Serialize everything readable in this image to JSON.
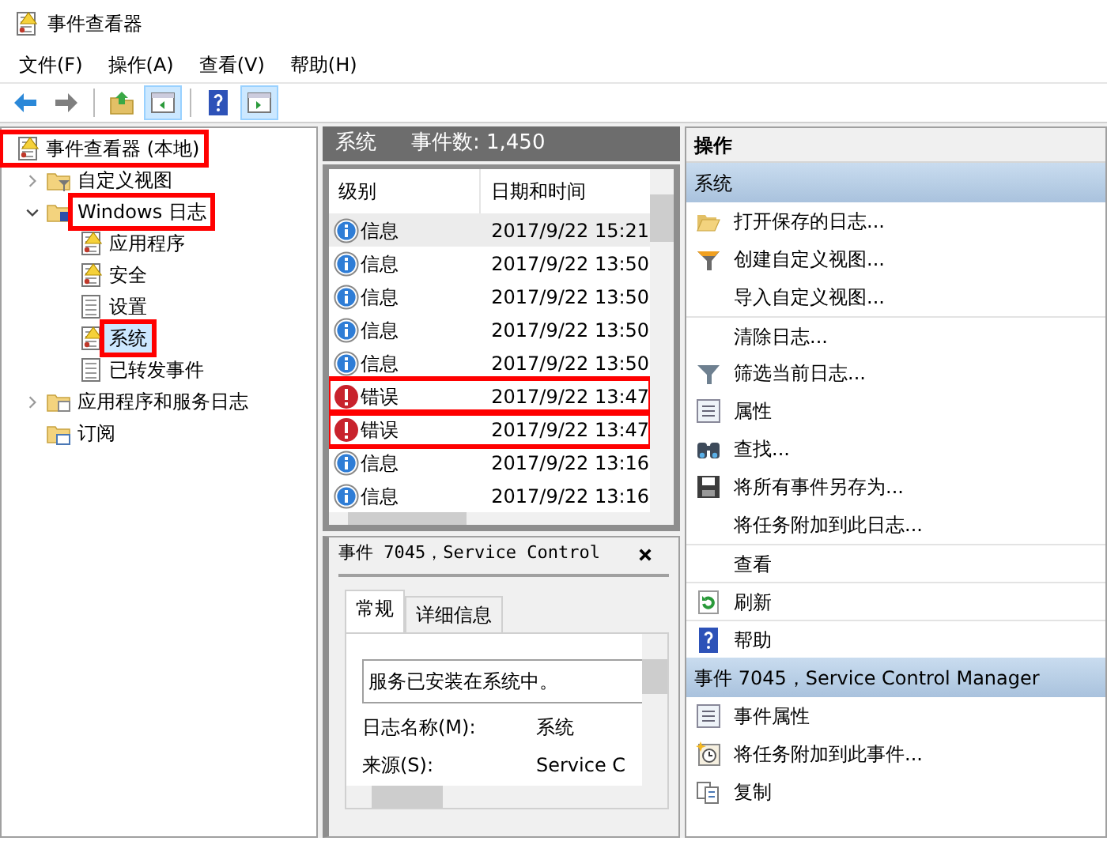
{
  "window": {
    "title": "事件查看器"
  },
  "menu": [
    "文件(F)",
    "操作(A)",
    "查看(V)",
    "帮助(H)"
  ],
  "toolbar": [
    {
      "kind": "back",
      "disabled": false,
      "pressed": false
    },
    {
      "kind": "forward",
      "disabled": true,
      "pressed": false
    },
    {
      "kind": "up",
      "disabled": false,
      "pressed": false
    },
    {
      "kind": "pane-left",
      "disabled": false,
      "pressed": true
    },
    {
      "kind": "help",
      "disabled": false,
      "pressed": false
    },
    {
      "kind": "pane-right",
      "disabled": false,
      "pressed": true
    }
  ],
  "tree": [
    {
      "label": "事件查看器 (本地)",
      "kind": "root",
      "selected": false,
      "highlighted": true,
      "children": [
        {
          "label": "自定义视图",
          "kind": "filter-folder",
          "expanded": false,
          "selected": false,
          "highlighted": false
        },
        {
          "label": "Windows 日志",
          "kind": "log-folder",
          "expanded": true,
          "selected": false,
          "highlighted": true,
          "children": [
            {
              "label": "应用程序",
              "kind": "log",
              "selected": false,
              "highlighted": false
            },
            {
              "label": "安全",
              "kind": "log",
              "selected": false,
              "highlighted": false
            },
            {
              "label": "设置",
              "kind": "log-plain",
              "selected": false,
              "highlighted": false
            },
            {
              "label": "系统",
              "kind": "log",
              "selected": true,
              "highlighted": true
            },
            {
              "label": "已转发事件",
              "kind": "log-plain",
              "selected": false,
              "highlighted": false
            }
          ]
        },
        {
          "label": "应用程序和服务日志",
          "kind": "folder",
          "expanded": false,
          "selected": false,
          "highlighted": false
        },
        {
          "label": "订阅",
          "kind": "sub-folder",
          "selected": false,
          "highlighted": false
        }
      ]
    }
  ],
  "events": {
    "title": "系统",
    "count": "事件数: 1,450",
    "columns": [
      "级别",
      "日期和时间"
    ],
    "rows": [
      {
        "kind": "info",
        "level": "信息",
        "date": "2017/9/22 15:21",
        "selected": true,
        "highlighted": false
      },
      {
        "kind": "info",
        "level": "信息",
        "date": "2017/9/22 13:50",
        "selected": false,
        "highlighted": false
      },
      {
        "kind": "info",
        "level": "信息",
        "date": "2017/9/22 13:50",
        "selected": false,
        "highlighted": false
      },
      {
        "kind": "info",
        "level": "信息",
        "date": "2017/9/22 13:50",
        "selected": false,
        "highlighted": false
      },
      {
        "kind": "info",
        "level": "信息",
        "date": "2017/9/22 13:50",
        "selected": false,
        "highlighted": false
      },
      {
        "kind": "error",
        "level": "错误",
        "date": "2017/9/22 13:47",
        "selected": false,
        "highlighted": true
      },
      {
        "kind": "error",
        "level": "错误",
        "date": "2017/9/22 13:47",
        "selected": false,
        "highlighted": true
      },
      {
        "kind": "info",
        "level": "信息",
        "date": "2017/9/22 13:16",
        "selected": false,
        "highlighted": false
      },
      {
        "kind": "info",
        "level": "信息",
        "date": "2017/9/22 13:16",
        "selected": false,
        "highlighted": false
      }
    ]
  },
  "detail": {
    "title": "事件 7045，Service Control",
    "tabs": [
      {
        "label": "常规",
        "selected": true
      },
      {
        "label": "详细信息",
        "selected": false
      }
    ],
    "description": "服务已安装在系统中。",
    "fields": [
      {
        "label": "日志名称(M):",
        "value": "系统"
      },
      {
        "label": "来源(S):",
        "value": "Service C"
      }
    ]
  },
  "actions": {
    "title": "操作",
    "sections": [
      {
        "title": "系统",
        "items": [
          {
            "label": "打开保存的日志...",
            "kind": "open-folder",
            "divider": false
          },
          {
            "label": "创建自定义视图...",
            "kind": "filter-star",
            "divider": false
          },
          {
            "label": "导入自定义视图...",
            "kind": "plain",
            "divider": false
          },
          {
            "label": "清除日志...",
            "kind": "plain",
            "divider": true
          },
          {
            "label": "筛选当前日志...",
            "kind": "filter",
            "divider": false
          },
          {
            "label": "属性",
            "kind": "properties",
            "divider": false
          },
          {
            "label": "查找...",
            "kind": "binoculars",
            "divider": false
          },
          {
            "label": "将所有事件另存为...",
            "kind": "save",
            "divider": false
          },
          {
            "label": "将任务附加到此日志...",
            "kind": "plain",
            "divider": false
          },
          {
            "label": "查看",
            "kind": "plain",
            "divider": true
          },
          {
            "label": "刷新",
            "kind": "refresh",
            "divider": true
          },
          {
            "label": "帮助",
            "kind": "help",
            "divider": true
          }
        ]
      },
      {
        "title": "事件 7045，Service Control Manager",
        "items": [
          {
            "label": "事件属性",
            "kind": "properties",
            "divider": false
          },
          {
            "label": "将任务附加到此事件...",
            "kind": "task",
            "divider": false
          },
          {
            "label": "复制",
            "kind": "copy",
            "divider": false
          }
        ]
      }
    ]
  }
}
